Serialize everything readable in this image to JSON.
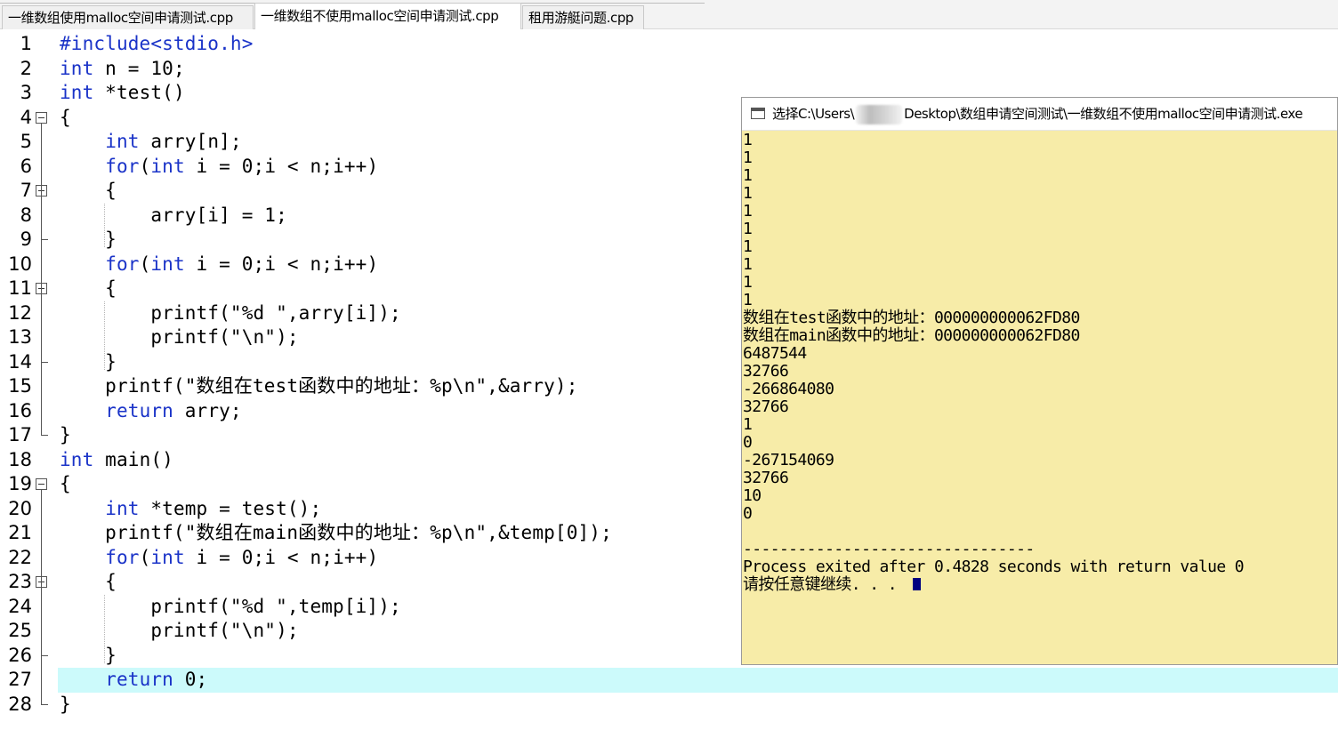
{
  "tabs": [
    {
      "label": "一维数组使用malloc空间申请测试.cpp",
      "active": false
    },
    {
      "label": "一维数组不使用malloc空间申请测试.cpp",
      "active": true
    },
    {
      "label": "租用游艇问题.cpp",
      "active": false
    }
  ],
  "editor": {
    "current_line": 27,
    "line_numbers": [
      "1",
      "2",
      "3",
      "4",
      "5",
      "6",
      "7",
      "8",
      "9",
      "10",
      "11",
      "12",
      "13",
      "14",
      "15",
      "16",
      "17",
      "18",
      "19",
      "20",
      "21",
      "22",
      "23",
      "24",
      "25",
      "26",
      "27",
      "28"
    ],
    "lines": [
      "#include<stdio.h>",
      "int n = 10;",
      "int *test()",
      "{",
      "    int arry[n];",
      "    for(int i = 0;i < n;i++)",
      "    {",
      "        arry[i] = 1;",
      "    }",
      "    for(int i = 0;i < n;i++)",
      "    {",
      "        printf(\"%d \",arry[i]);",
      "        printf(\"\\n\");",
      "    }",
      "    printf(\"数组在test函数中的地址：%p\\n\",&arry);",
      "    return arry;",
      "}",
      "int main()",
      "{",
      "    int *temp = test();",
      "    printf(\"数组在main函数中的地址：%p\\n\",&temp[0]);",
      "    for(int i = 0;i < n;i++)",
      "    {",
      "        printf(\"%d \",temp[i]);",
      "        printf(\"\\n\");",
      "    }",
      "    return 0;",
      "}"
    ]
  },
  "console": {
    "title_prefix": "选择C:\\Users\\",
    "title_suffix": "Desktop\\数组申请空间测试\\一维数组不使用malloc空间申请测试.exe",
    "output": [
      "1",
      "1",
      "1",
      "1",
      "1",
      "1",
      "1",
      "1",
      "1",
      "1",
      "数组在test函数中的地址：000000000062FD80",
      "数组在main函数中的地址：000000000062FD80",
      "6487544",
      "32766",
      "-266864080",
      "32766",
      "1",
      "0",
      "-267154069",
      "32766",
      "10",
      "0",
      "",
      "--------------------------------",
      "Process exited after 0.4828 seconds with return value 0",
      "请按任意键继续. . . "
    ]
  },
  "colors": {
    "keyword": "#1a33c8",
    "current_line_bg": "#ccfafb",
    "console_bg": "#f7eca8",
    "cursor": "#000080"
  }
}
